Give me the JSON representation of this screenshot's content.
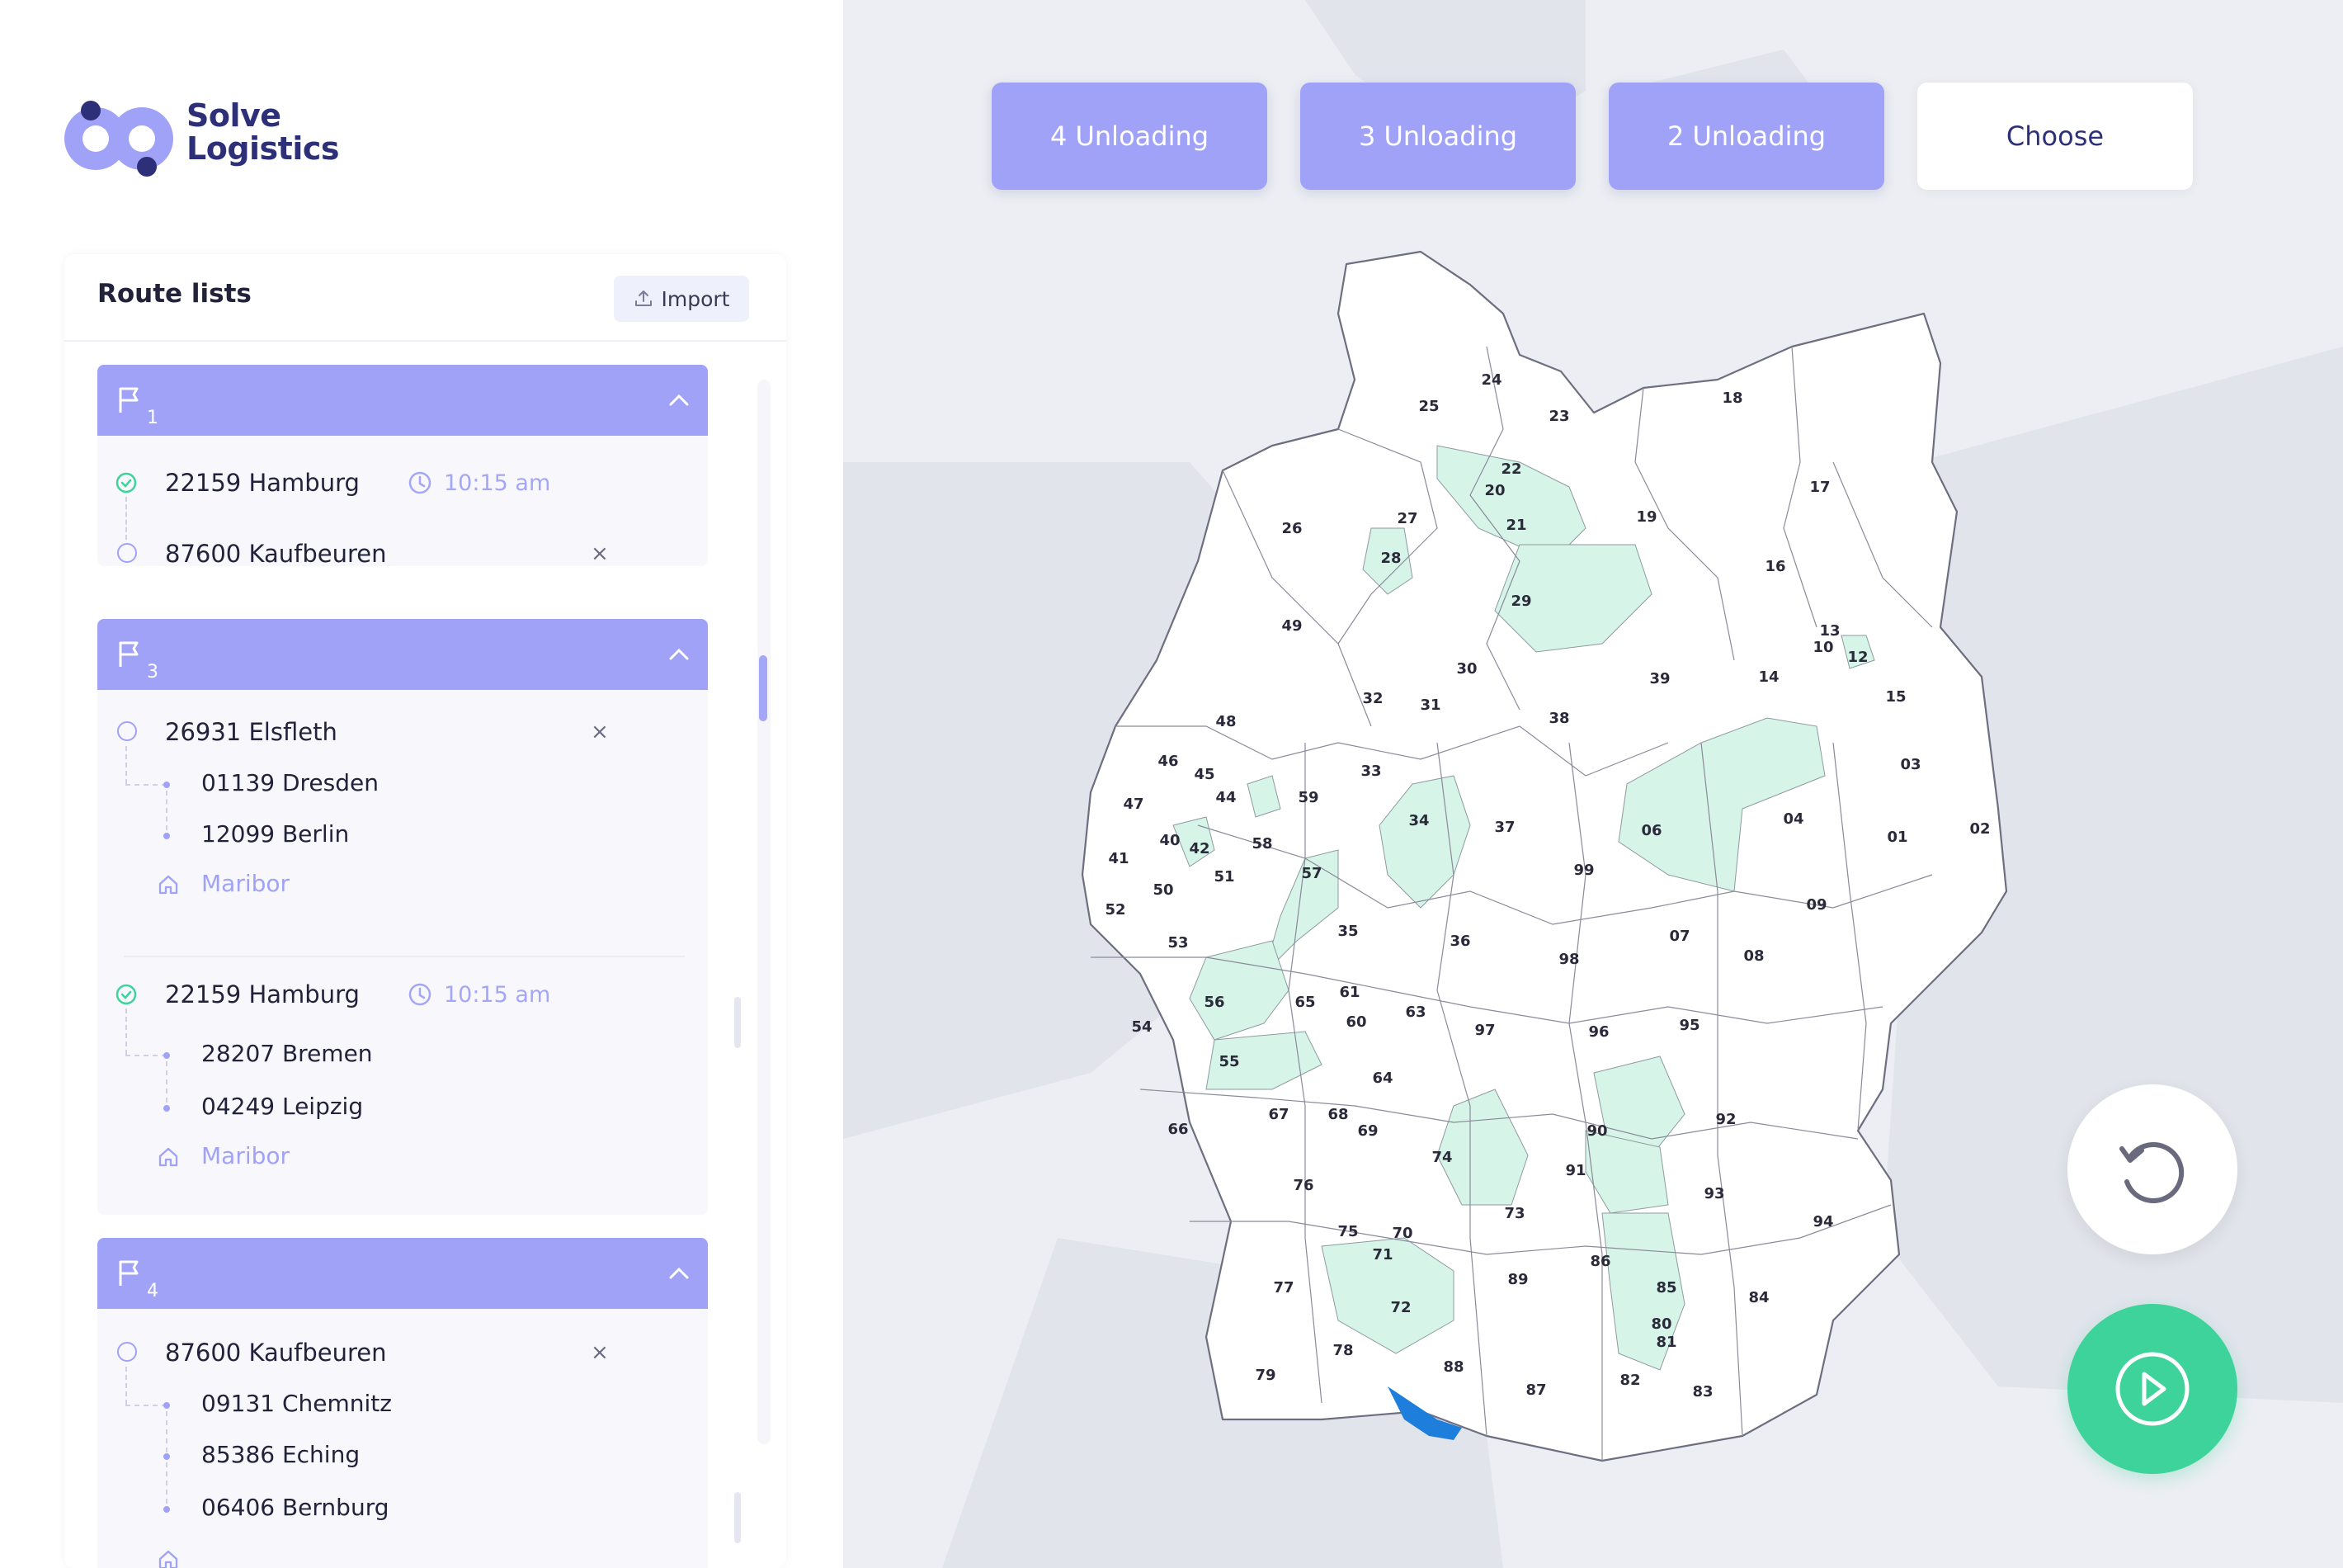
{
  "brand": {
    "line1": "Solve",
    "line2": "Logistics"
  },
  "panel": {
    "title": "Route lists",
    "import_label": "Import"
  },
  "routes": [
    {
      "number": "1",
      "stops": [
        {
          "name": "22159 Hamburg",
          "time": "10:15 am"
        },
        {
          "name": "87600 Kaufbeuren"
        }
      ]
    },
    {
      "number": "3",
      "groups": [
        {
          "origin": "26931 Elsfleth",
          "subs": [
            "01139 Dresden",
            "12099 Berlin"
          ],
          "depot": "Maribor"
        },
        {
          "origin": "22159 Hamburg",
          "time": "10:15 am",
          "subs": [
            "28207 Bremen",
            "04249 Leipzig"
          ],
          "depot": "Maribor"
        }
      ]
    },
    {
      "number": "4",
      "origin": "87600 Kaufbeuren",
      "subs": [
        "09131 Chemnitz",
        "85386 Eching",
        "06406 Bernburg"
      ]
    }
  ],
  "tabs": [
    "4 Unloading",
    "3 Unloading",
    "2 Unloading",
    "Choose"
  ],
  "map": {
    "regions": [
      "01",
      "02",
      "03",
      "04",
      "06",
      "07",
      "08",
      "09",
      "10",
      "12",
      "13",
      "14",
      "15",
      "16",
      "17",
      "18",
      "19",
      "20",
      "21",
      "22",
      "23",
      "24",
      "25",
      "26",
      "27",
      "28",
      "29",
      "30",
      "31",
      "32",
      "33",
      "34",
      "35",
      "36",
      "37",
      "38",
      "39",
      "40",
      "41",
      "42",
      "44",
      "45",
      "46",
      "47",
      "48",
      "49",
      "50",
      "51",
      "52",
      "53",
      "54",
      "55",
      "56",
      "57",
      "58",
      "59",
      "60",
      "61",
      "63",
      "64",
      "65",
      "66",
      "67",
      "68",
      "69",
      "70",
      "71",
      "72",
      "73",
      "74",
      "75",
      "76",
      "77",
      "78",
      "79",
      "80",
      "81",
      "82",
      "83",
      "84",
      "85",
      "86",
      "87",
      "88",
      "89",
      "90",
      "91",
      "92",
      "93",
      "94",
      "95",
      "96",
      "97",
      "98",
      "99"
    ],
    "highlighted": [
      "06",
      "12",
      "21",
      "28",
      "29",
      "34",
      "40",
      "44",
      "55",
      "56",
      "57",
      "72",
      "74",
      "86",
      "90",
      "91"
    ]
  },
  "colors": {
    "accent": "#a0a2f8",
    "brand": "#2d3078",
    "highlight": "#d6f4e8",
    "play": "#3ed39a"
  }
}
